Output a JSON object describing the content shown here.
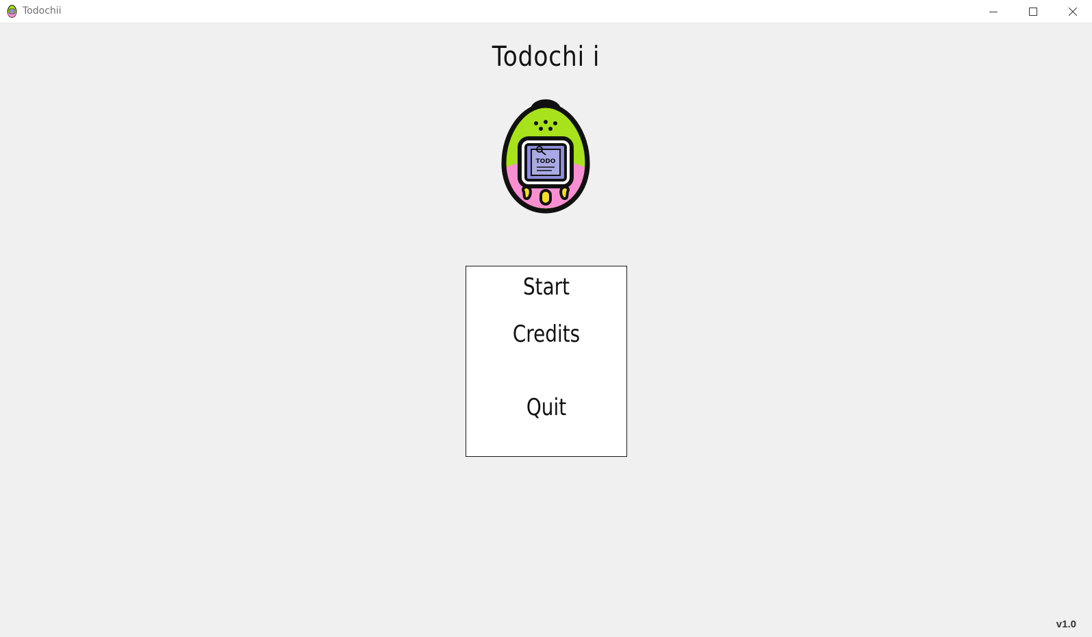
{
  "window": {
    "title": "Todochii",
    "controls": {
      "minimize_icon": "minimize-icon",
      "maximize_icon": "maximize-icon",
      "close_icon": "close-icon"
    }
  },
  "main": {
    "title": "Todochi i",
    "logo_icon": "tamagotchi-todo-icon",
    "logo_screen_text": "TODO",
    "menu": {
      "start": "Start",
      "credits": "Credits",
      "quit": "Quit"
    },
    "version": "v1.0"
  },
  "colors": {
    "background": "#f0f0f0",
    "egg_top": "#a7e21c",
    "egg_bottom": "#f78fd0",
    "screen": "#8e8ed8",
    "buttons": "#f4dc2c",
    "outline": "#111111"
  }
}
